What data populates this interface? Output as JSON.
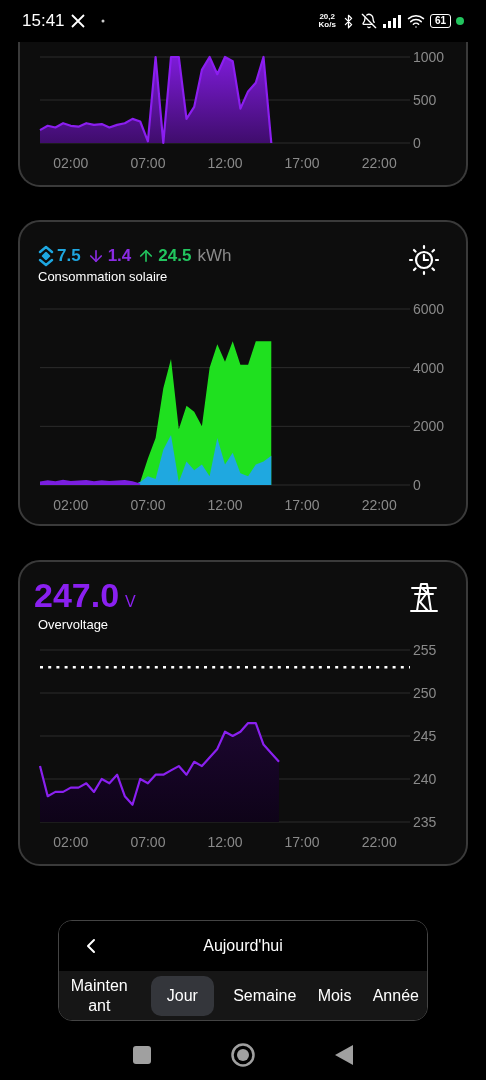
{
  "status_bar": {
    "time": "15:41",
    "speed_value": "20,2",
    "speed_unit": "Ko/s",
    "battery": "61"
  },
  "cards": [
    {
      "kind": "power",
      "chart_data": {
        "type": "area",
        "grid": true,
        "xlim": [
          0,
          24
        ],
        "ylim": [
          0,
          1000
        ],
        "xticks": [
          {
            "value": 2,
            "label": "02:00"
          },
          {
            "value": 7,
            "label": "07:00"
          },
          {
            "value": 12,
            "label": "12:00"
          },
          {
            "value": 17,
            "label": "17:00"
          },
          {
            "value": 22,
            "label": "22:00"
          }
        ],
        "yticks": [
          0,
          500,
          1000
        ],
        "x": [
          0,
          0.5,
          1,
          1.5,
          2,
          2.5,
          3,
          3.5,
          4,
          4.5,
          5,
          5.5,
          6,
          6.5,
          7,
          7.5,
          8,
          8.5,
          9,
          9.5,
          10,
          10.5,
          11,
          11.5,
          12,
          12.5,
          13,
          13.5,
          14,
          14.5,
          15
        ],
        "series": [
          {
            "color": "#8b1ef0",
            "values": [
              150,
              200,
              180,
              230,
              200,
              190,
              230,
              210,
              220,
              180,
              210,
              230,
              280,
              250,
              20,
              1000,
              0,
              1000,
              1000,
              280,
              420,
              850,
              1000,
              800,
              1000,
              950,
              400,
              600,
              700,
              1000,
              0
            ]
          }
        ]
      }
    },
    {
      "kind": "solar",
      "stats": [
        {
          "kind": "self",
          "value": "7.5",
          "color": "#1ea7e1"
        },
        {
          "kind": "import",
          "value": "1.4",
          "color": "#8a2be2"
        },
        {
          "kind": "export",
          "value": "24.5",
          "color": "#22c55e"
        }
      ],
      "unit": "kWh",
      "label": "Consommation solaire",
      "chart_data": {
        "type": "area",
        "grid": true,
        "xlim": [
          0,
          24
        ],
        "ylim": [
          0,
          6000
        ],
        "xticks": [
          {
            "value": 2,
            "label": "02:00"
          },
          {
            "value": 7,
            "label": "07:00"
          },
          {
            "value": 12,
            "label": "12:00"
          },
          {
            "value": 17,
            "label": "17:00"
          },
          {
            "value": 22,
            "label": "22:00"
          }
        ],
        "yticks": [
          0,
          2000,
          4000,
          6000
        ],
        "x": [
          0,
          0.5,
          1,
          1.5,
          2,
          2.5,
          3,
          3.5,
          4,
          4.5,
          5,
          5.5,
          6,
          6.5,
          7,
          7.5,
          8,
          8.5,
          9,
          9.5,
          10,
          10.5,
          11,
          11.5,
          12,
          12.5,
          13,
          13.5,
          14,
          14.5,
          15
        ],
        "series": [
          {
            "color": "#1fe01f",
            "values": [
              null,
              null,
              null,
              null,
              null,
              null,
              null,
              null,
              null,
              null,
              null,
              null,
              0,
              100,
              900,
              1600,
              3300,
              4300,
              1900,
              2700,
              2500,
              2000,
              4000,
              4800,
              4200,
              4900,
              4100,
              4100,
              4900,
              4900,
              4900
            ]
          },
          {
            "color": "#1fa8e0",
            "values": [
              null,
              null,
              null,
              null,
              null,
              null,
              null,
              null,
              null,
              null,
              null,
              null,
              0,
              100,
              300,
              200,
              1200,
              1700,
              100,
              800,
              500,
              700,
              300,
              1600,
              700,
              1100,
              400,
              300,
              700,
              800,
              1000
            ]
          },
          {
            "color": "#7a1ee0",
            "values": [
              120,
              160,
              130,
              180,
              140,
              150,
              170,
              130,
              160,
              140,
              150,
              170,
              130,
              50,
              null,
              null,
              null,
              null,
              null,
              null,
              null,
              null,
              null,
              null,
              null,
              null,
              null,
              null,
              null,
              null,
              null
            ]
          }
        ]
      }
    },
    {
      "kind": "voltage",
      "value": "247.0",
      "unit": "V",
      "label": "Overvoltage",
      "chart_data": {
        "type": "area",
        "grid": true,
        "xlim": [
          0,
          24
        ],
        "ylim": [
          235,
          255
        ],
        "xticks": [
          {
            "value": 2,
            "label": "02:00"
          },
          {
            "value": 7,
            "label": "07:00"
          },
          {
            "value": 12,
            "label": "12:00"
          },
          {
            "value": 17,
            "label": "17:00"
          },
          {
            "value": 22,
            "label": "22:00"
          }
        ],
        "yticks": [
          235,
          240,
          245,
          250,
          255
        ],
        "ref_lines": [
          {
            "axis": "y",
            "value": 253
          }
        ],
        "x": [
          0,
          0.5,
          1,
          1.5,
          2,
          2.5,
          3,
          3.5,
          4,
          4.5,
          5,
          5.5,
          6,
          6.5,
          7,
          7.5,
          8,
          8.5,
          9,
          9.5,
          10,
          10.5,
          11,
          11.5,
          12,
          12.5,
          13,
          13.5,
          14,
          14.5,
          15,
          15.5
        ],
        "series": [
          {
            "color": "#8a20f0",
            "values": [
              241.5,
              238,
              238.5,
              238.5,
              239,
              239,
              239.5,
              238.5,
              240,
              239.5,
              240.5,
              238,
              237,
              240,
              239.5,
              240.5,
              240.5,
              241,
              241.5,
              240.5,
              242,
              241.5,
              242.5,
              243.5,
              245.5,
              245,
              245.5,
              246.5,
              246.5,
              244,
              243,
              242
            ]
          }
        ]
      }
    }
  ],
  "period_selector": {
    "title": "Aujourd'hui",
    "tabs": [
      {
        "label": "Maintenant",
        "selected": false
      },
      {
        "label": "Jour",
        "selected": true
      },
      {
        "label": "Semaine",
        "selected": false
      },
      {
        "label": "Mois",
        "selected": false
      },
      {
        "label": "Année",
        "selected": false
      }
    ]
  }
}
